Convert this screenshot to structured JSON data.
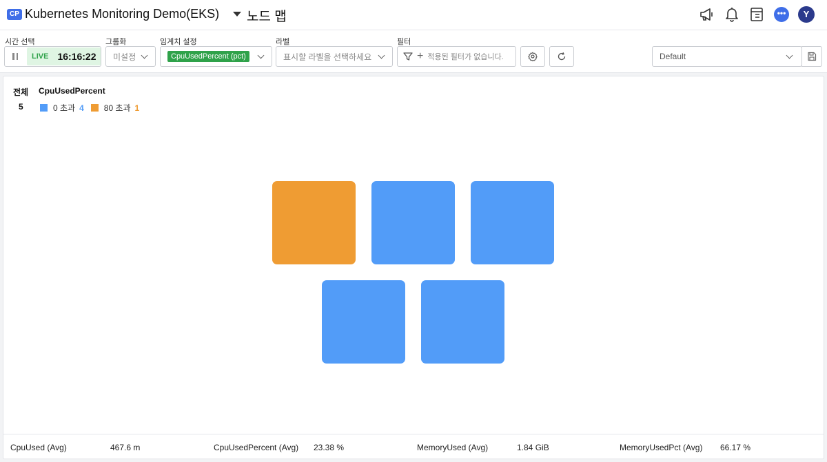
{
  "header": {
    "project_badge": "CP",
    "project_name": "Kubernetes Monitoring Demo(EKS)",
    "page_title": "노드 맵",
    "avatar_letter": "Y",
    "chat_glyph": "•••"
  },
  "toolbar": {
    "time_label": "시간 선택",
    "live_label": "LIVE",
    "live_time": "16:16:22",
    "group_label": "그룹화",
    "group_value": "미설정",
    "threshold_label": "임계치 설정",
    "threshold_value": "CpuUsedPercent (pct)",
    "label_label": "라벨",
    "label_placeholder": "표시할 라벨을 선택하세요",
    "filter_label": "필터",
    "filter_placeholder": "적용된 필터가 없습니다.",
    "preset_value": "Default"
  },
  "legend": {
    "total_header": "전체",
    "total_value": "5",
    "metric": "CpuUsedPercent",
    "items": [
      {
        "label": "0 초과",
        "count": "4",
        "color": "#529cf8"
      },
      {
        "label": "80 초과",
        "count": "1",
        "color": "#ef9c33"
      }
    ]
  },
  "nodes": [
    {
      "color": "#ef9c33"
    },
    {
      "color": "#529cf8"
    },
    {
      "color": "#529cf8"
    },
    {
      "color": "#529cf8"
    },
    {
      "color": "#529cf8"
    }
  ],
  "footer": {
    "stats": [
      {
        "label": "CpuUsed (Avg)",
        "value": "467.6 m"
      },
      {
        "label": "CpuUsedPercent (Avg)",
        "value": "23.38 %"
      },
      {
        "label": "MemoryUsed (Avg)",
        "value": "1.84 GiB"
      },
      {
        "label": "MemoryUsedPct (Avg)",
        "value": "66.17 %"
      }
    ]
  }
}
